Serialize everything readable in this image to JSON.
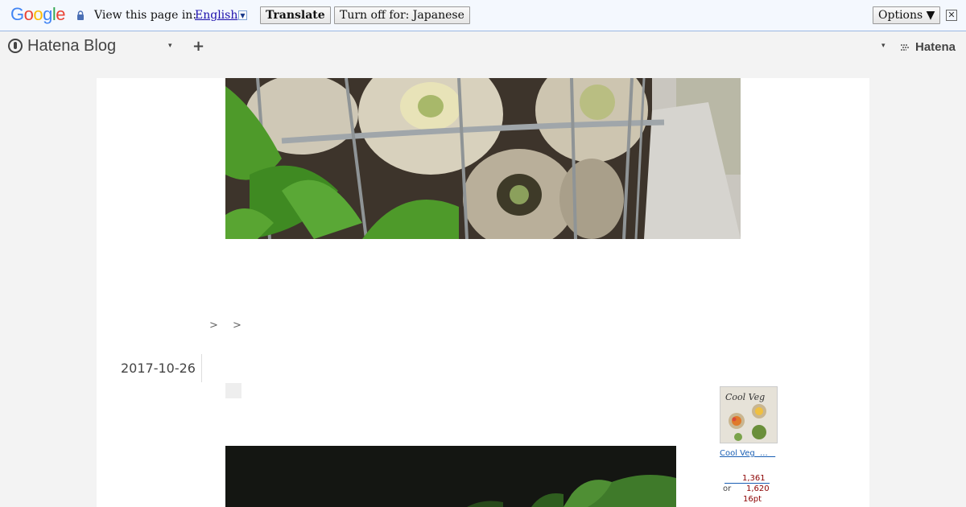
{
  "translate_bar": {
    "logo_letters": [
      "G",
      "o",
      "o",
      "g",
      "l",
      "e"
    ],
    "logo_colors": [
      "#4285F4",
      "#EA4335",
      "#FBBC05",
      "#4285F4",
      "#34A853",
      "#EA4335"
    ],
    "prompt": "View this page in:",
    "language": "English",
    "translate_label": "Translate",
    "turn_off_label": "Turn off for: Japanese",
    "options_label": "Options ▼",
    "close_glyph": "✕"
  },
  "hatena_header": {
    "blog_title": "Hatena Blog",
    "caret": "▾",
    "plus": "+",
    "right_caret": "▾",
    "brand": "Hatena"
  },
  "breadcrumb": {
    "separators": [
      ">",
      ">"
    ]
  },
  "post": {
    "date": "2017-10-26"
  },
  "sidebar_ad": {
    "book_cover_title": "Cool Veg",
    "link_text": "Cool Veg  ...   ",
    "price_new": "1,361",
    "or_label": "or",
    "price_alt": "1,620",
    "points": "16pt"
  },
  "colors": {
    "accent_link": "#1a0dab",
    "price": "#8b0000",
    "translate_bar_bg": "#f4f8fe"
  }
}
